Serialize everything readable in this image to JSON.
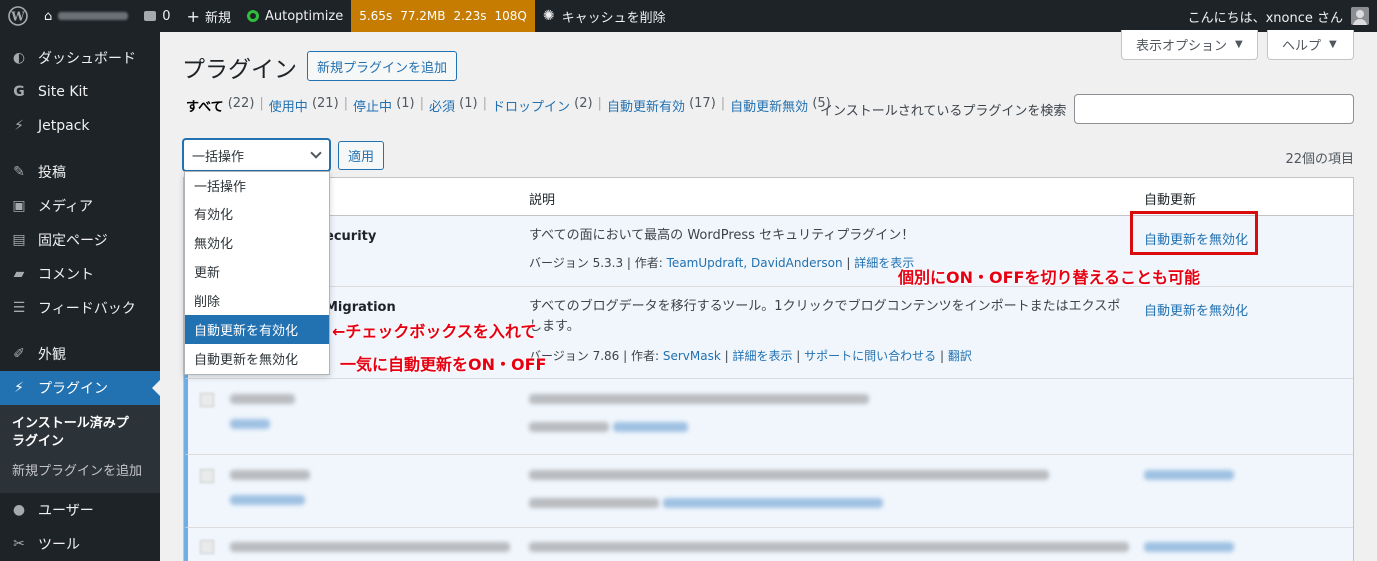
{
  "adminbar": {
    "comments_count": "0",
    "new_label": "新規",
    "autoptimize_label": "Autoptimize",
    "perf": {
      "time": "5.65s",
      "memory": "77.2MB",
      "db_time": "2.23s",
      "queries": "108Q"
    },
    "cache_label": "キャッシュを削除",
    "greeting": "こんにちは、xnonce さん"
  },
  "sidebar": {
    "items": [
      {
        "label": "ダッシュボード",
        "icon": "dashboard-icon",
        "glyph": "◐"
      },
      {
        "label": "Site Kit",
        "icon": "sitekit-icon",
        "glyph": "G"
      },
      {
        "label": "Jetpack",
        "icon": "jetpack-icon",
        "glyph": "⚡"
      },
      {
        "label": "投稿",
        "icon": "pin-icon",
        "glyph": "✎"
      },
      {
        "label": "メディア",
        "icon": "media-icon",
        "glyph": "▣"
      },
      {
        "label": "固定ページ",
        "icon": "page-icon",
        "glyph": "▤"
      },
      {
        "label": "コメント",
        "icon": "comment-icon",
        "glyph": "▰"
      },
      {
        "label": "フィードバック",
        "icon": "feedback-icon",
        "glyph": "☰"
      },
      {
        "label": "外観",
        "icon": "brush-icon",
        "glyph": "✐"
      },
      {
        "label": "プラグイン",
        "icon": "plugin-icon",
        "glyph": "⚡"
      },
      {
        "label": "ユーザー",
        "icon": "user-icon",
        "glyph": "●"
      },
      {
        "label": "ツール",
        "icon": "wrench-icon",
        "glyph": "✂"
      }
    ],
    "submenu": [
      "インストール済みプラグイン",
      "新規プラグインを追加"
    ]
  },
  "header": {
    "screen_options": "表示オプション",
    "help": "ヘルプ",
    "title": "プラグイン",
    "add_new": "新規プラグインを追加"
  },
  "filters": [
    {
      "label": "すべて",
      "count": "(22)"
    },
    {
      "label": "使用中",
      "count": "(21)"
    },
    {
      "label": "停止中",
      "count": "(1)"
    },
    {
      "label": "必須",
      "count": "(1)"
    },
    {
      "label": "ドロップイン",
      "count": "(2)"
    },
    {
      "label": "自動更新有効",
      "count": "(17)"
    },
    {
      "label": "自動更新無効",
      "count": "(5)"
    }
  ],
  "search": {
    "label": "インストールされているプラグインを検索",
    "value": ""
  },
  "bulk": {
    "selected": "一括操作",
    "apply": "適用",
    "items_count": "22個の項目",
    "options": [
      "一括操作",
      "有効化",
      "無効化",
      "更新",
      "削除",
      "自動更新を有効化",
      "自動更新を無効化"
    ]
  },
  "table": {
    "col_description": "説明",
    "col_autoupdate": "自動更新",
    "rows": [
      {
        "name_visible": "ecurity",
        "description": "すべての面において最高の WordPress セキュリティプラグイン！",
        "version_text": "バージョン 5.3.3 | 作者: ",
        "author": "TeamUpdraft, DavidAnderson",
        "sep": " | ",
        "details": "詳細を表示",
        "autoupdate": "自動更新を無効化"
      },
      {
        "name_visible": "Migration",
        "description_line1": "すべてのブログデータを移行するツール。1クリックでブログコンテンツをインポートまたはエクスポ",
        "description_line2": "します。",
        "version_text": "バージョン 7.86 | 作者: ",
        "author": "ServMask",
        "details": "詳細を表示",
        "support": "サポートに問い合わせる",
        "translate": "翻訳",
        "autoupdate": "自動更新を無効化"
      }
    ]
  },
  "annotations": {
    "individual": "個別にON・OFFを切り替えることも可能",
    "checkbox": "←チェックボックスを入れて",
    "bulk": "一気に自動更新をON・OFF"
  },
  "colors": {
    "accent": "#2271b1",
    "annotation": "#e60012",
    "adminbar": "#1d2327",
    "perf": "#c67c00"
  }
}
